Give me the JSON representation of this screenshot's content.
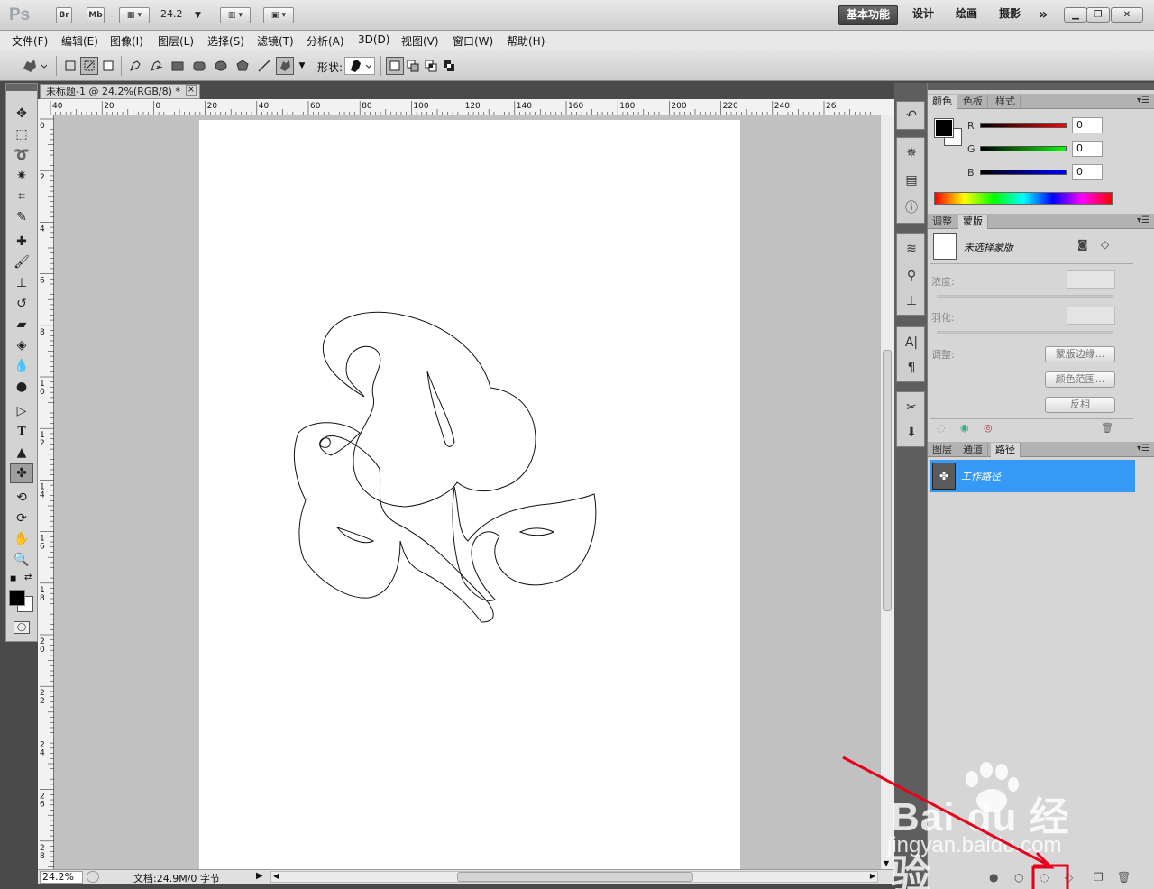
{
  "app": {
    "logo": "Ps",
    "bridge_label": "Br",
    "minibridge_label": "Mb",
    "zoom_value": "24.2",
    "workspaces": [
      {
        "label": "基本功能",
        "active": true
      },
      {
        "label": "设计",
        "active": false
      },
      {
        "label": "绘画",
        "active": false
      },
      {
        "label": "摄影",
        "active": false
      }
    ],
    "more_workspaces": "»"
  },
  "menu": [
    "文件(F)",
    "编辑(E)",
    "图像(I)",
    "图层(L)",
    "选择(S)",
    "滤镜(T)",
    "分析(A)",
    "3D(D)",
    "视图(V)",
    "窗口(W)",
    "帮助(H)"
  ],
  "options": {
    "shape_label": "形状:"
  },
  "document": {
    "tab_title": "未标题-1 @ 24.2%(RGB/8) *",
    "close": "×",
    "ruler_h_labels": [
      "40",
      "20",
      "0",
      "20",
      "40",
      "60",
      "80",
      "100",
      "120",
      "140",
      "160",
      "180",
      "200",
      "220",
      "240",
      "26"
    ],
    "ruler_v_labels": [
      "0",
      "2",
      "4",
      "6",
      "8",
      "10",
      "12",
      "14",
      "16",
      "18",
      "20",
      "22",
      "24",
      "26",
      "28"
    ]
  },
  "status": {
    "zoom": "24.2%",
    "doc_info": "文档:24.9M/0 字节"
  },
  "panels": {
    "color": {
      "tabs": [
        "颜色",
        "色板",
        "样式"
      ],
      "channels": [
        {
          "label": "R",
          "value": "0",
          "color": "#e00000"
        },
        {
          "label": "G",
          "value": "0",
          "color": "#00c800"
        },
        {
          "label": "B",
          "value": "0",
          "color": "#0000e0"
        }
      ]
    },
    "masks": {
      "tabs": [
        "调整",
        "蒙版"
      ],
      "title": "未选择蒙版",
      "density_label": "浓度:",
      "feather_label": "羽化:",
      "refine_label": "调整:",
      "buttons": [
        "蒙版边缘...",
        "颜色范围...",
        "反相"
      ]
    },
    "layers": {
      "tabs": [
        "图层",
        "通道",
        "路径"
      ],
      "path_name": "工作路径"
    }
  },
  "watermark": {
    "brand": "Bai du 经验",
    "url": "jingyan.baidu.com"
  },
  "colors": {
    "accent": "#3799f6",
    "arrow": "#e8001a"
  }
}
